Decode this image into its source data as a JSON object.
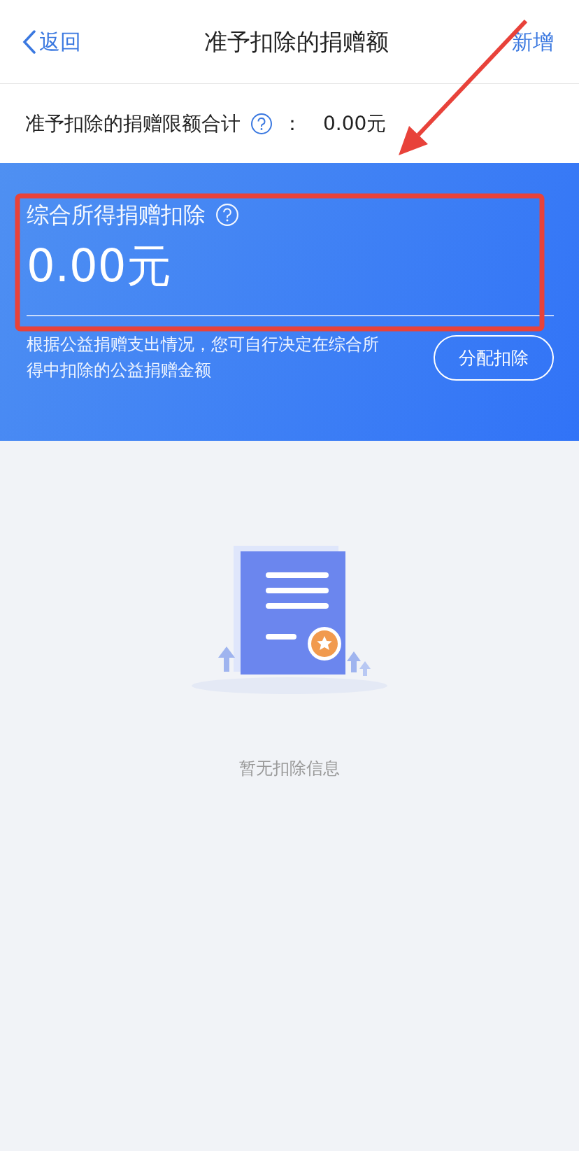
{
  "nav": {
    "back": "返回",
    "title": "准予扣除的捐赠额",
    "action": "新增"
  },
  "limit": {
    "label": "准予扣除的捐赠限额合计",
    "separator": "：",
    "amount": "0.00元"
  },
  "summary": {
    "title": "综合所得捐赠扣除",
    "amount": "0.00元",
    "note": "根据公益捐赠支出情况，您可自行决定在综合所得中扣除的公益捐赠金额",
    "button": "分配扣除"
  },
  "empty": {
    "message": "暂无扣除信息"
  }
}
